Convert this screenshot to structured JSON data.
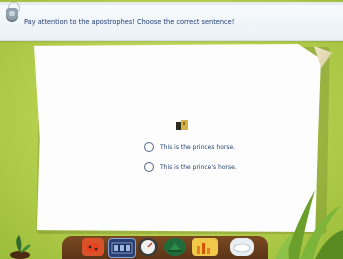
{
  "instruction": "Pay attention to the apostrophes! Choose the correct sentence!",
  "options": [
    {
      "label": "This is the princes horse."
    },
    {
      "label": "This is the prince's horse."
    }
  ],
  "colors": {
    "background": "#b6cf4e",
    "text": "#203a75",
    "toolbar": "#6b3e1c"
  },
  "toolbar": {
    "tools": [
      "ladybug-icon",
      "calculator-icon",
      "speedometer-icon",
      "hat-icon",
      "chart-icon",
      "cloud-icon"
    ]
  }
}
